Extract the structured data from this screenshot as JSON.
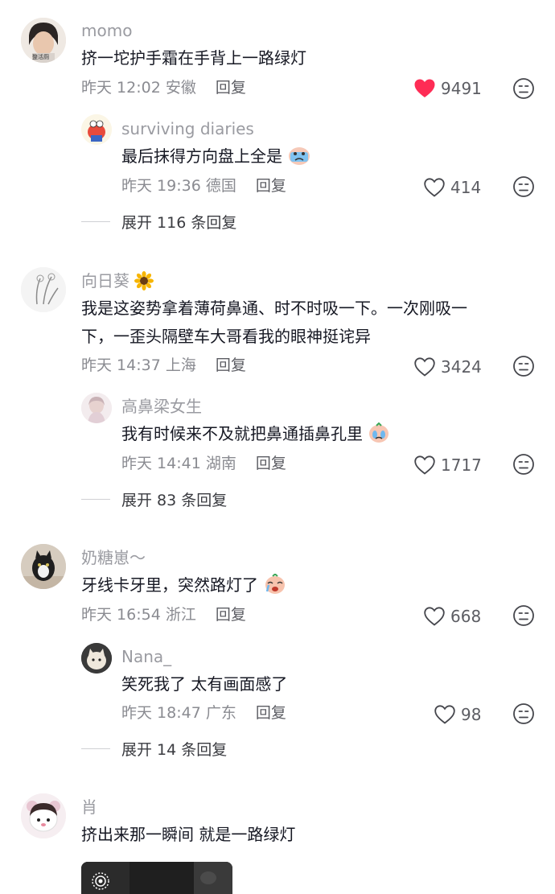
{
  "comments": [
    {
      "username": "momo",
      "avatar_text": "整活厕",
      "text": "挤一坨护手霜在手背上一路绿灯",
      "time": "昨天 12:02",
      "location": "安徽",
      "reply_label": "回复",
      "likes": "9491",
      "liked": true,
      "replies": [
        {
          "username": "surviving diaries",
          "text": "最后抹得方向盘上全是",
          "time": "昨天 19:36",
          "location": "德国",
          "reply_label": "回复",
          "likes": "414"
        }
      ],
      "expand_label": "展开 116 条回复"
    },
    {
      "username": "向日葵",
      "text_lines": [
        "我是这姿势拿着薄荷鼻通、时不时吸一下。一次刚吸一",
        "下，一歪头隔壁车大哥看我的眼神挺诧异"
      ],
      "time": "昨天 14:37",
      "location": "上海",
      "reply_label": "回复",
      "likes": "3424",
      "replies": [
        {
          "username": "高鼻梁女生",
          "text": "我有时候来不及就把鼻通插鼻孔里",
          "time": "昨天 14:41",
          "location": "湖南",
          "reply_label": "回复",
          "likes": "1717"
        }
      ],
      "expand_label": "展开 83 条回复"
    },
    {
      "username": "奶糖崽～",
      "text": "牙线卡牙里，突然路灯了",
      "time": "昨天 16:54",
      "location": "浙江",
      "reply_label": "回复",
      "likes": "668",
      "replies": [
        {
          "username": "Nana_",
          "text": "笑死我了 太有画面感了",
          "time": "昨天 18:47",
          "location": "广东",
          "reply_label": "回复",
          "likes": "98"
        }
      ],
      "expand_label": "展开 14 条回复"
    },
    {
      "username": "肖",
      "text": "挤出来那一瞬间 就是一路绿灯"
    }
  ],
  "colors": {
    "like_active": "#fe2c55",
    "text": "#161823",
    "secondary": "#8a8b91"
  }
}
